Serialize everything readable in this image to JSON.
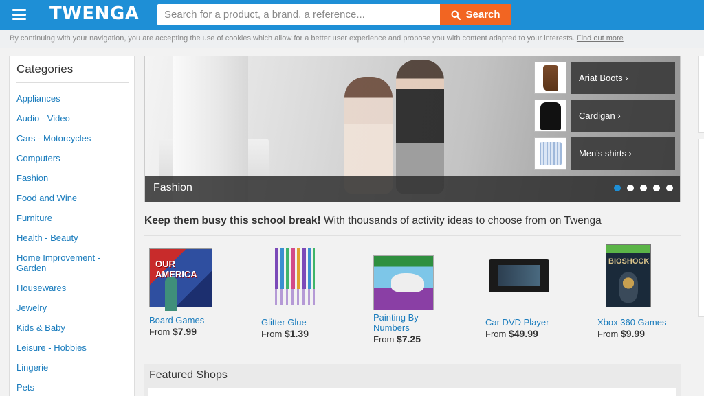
{
  "header": {
    "logo": "TWENGA",
    "search_placeholder": "Search for a product, a brand, a reference...",
    "search_label": "Search",
    "colors": {
      "bar": "#1e8fd6",
      "search_button": "#f26522"
    }
  },
  "cookie": {
    "text": "By continuing with your navigation, you are accepting the use of cookies which allow for a better user experience and propose you with content adapted to your interests.",
    "link": "Find out more"
  },
  "sidebar": {
    "title": "Categories",
    "items": [
      "Appliances",
      "Audio - Video",
      "Cars - Motorcycles",
      "Computers",
      "Fashion",
      "Food and Wine",
      "Furniture",
      "Health - Beauty",
      "Home Improvement - Garden",
      "Housewares",
      "Jewelry",
      "Kids & Baby",
      "Leisure - Hobbies",
      "Lingerie",
      "Pets"
    ]
  },
  "banner": {
    "caption": "Fashion",
    "links": [
      "Ariat Boots ›",
      "Cardigan ›",
      "Men's shirts ›"
    ],
    "dots_total": 5,
    "dots_active": 1
  },
  "promo": {
    "bold": "Keep them busy this school break!",
    "rest": " With thousands of activity ideas to choose from on Twenga"
  },
  "products": [
    {
      "name": "Board Games",
      "from": "From",
      "price": "$7.99"
    },
    {
      "name": "Glitter Glue",
      "from": "From",
      "price": "$1.39"
    },
    {
      "name": "Painting By Numbers",
      "from": "From",
      "price": "$7.25"
    },
    {
      "name": "Car DVD Player",
      "from": "From",
      "price": "$49.99"
    },
    {
      "name": "Xbox 360 Games",
      "from": "From",
      "price": "$9.99"
    }
  ],
  "featured": {
    "title": "Featured Shops"
  }
}
